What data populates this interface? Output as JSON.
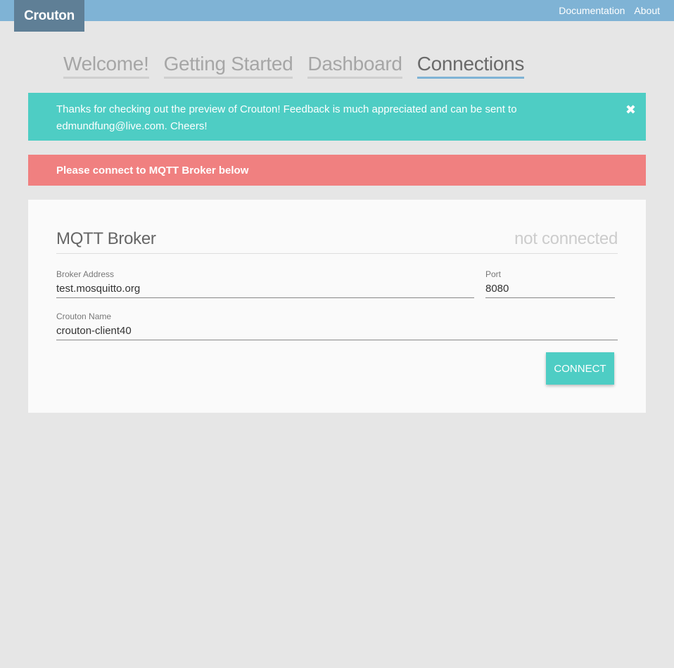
{
  "header": {
    "brand": "Crouton",
    "links": [
      "Documentation",
      "About"
    ]
  },
  "tabs": [
    {
      "label": "Welcome!",
      "active": false
    },
    {
      "label": "Getting Started",
      "active": false
    },
    {
      "label": "Dashboard",
      "active": false
    },
    {
      "label": "Connections",
      "active": true
    }
  ],
  "alerts": {
    "info_text": "Thanks for checking out the preview of Crouton! Feedback is much appreciated and can be sent to edmundfung@live.com. Cheers!",
    "danger_text": "Please connect to MQTT Broker below"
  },
  "broker": {
    "title": "MQTT Broker",
    "status": "not connected",
    "address_label": "Broker Address",
    "address_value": "test.mosquitto.org",
    "port_label": "Port",
    "port_value": "8080",
    "name_label": "Crouton Name",
    "name_value": "crouton-client40",
    "connect_label": "CONNECT"
  },
  "colors": {
    "topbar": "#7fb3d5",
    "brand_bg": "#5f7f96",
    "accent": "#4ecdc4",
    "danger": "#f08080",
    "background": "#e6e6e6"
  }
}
